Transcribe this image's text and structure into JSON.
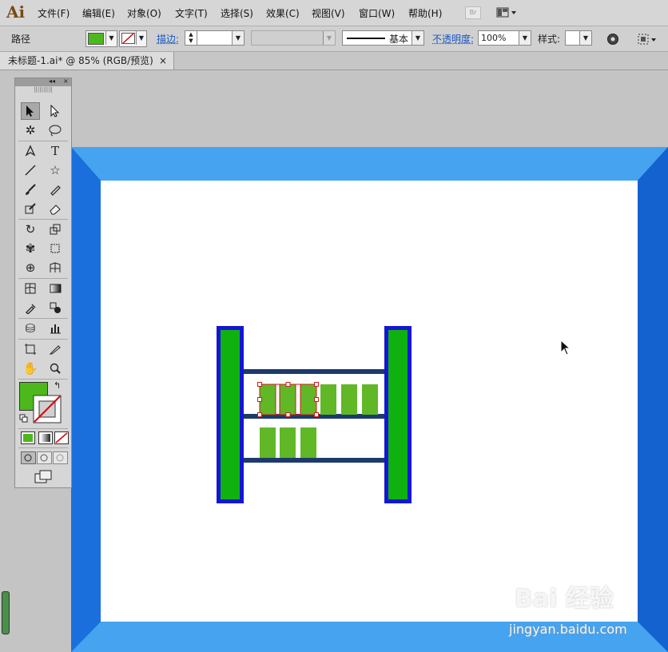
{
  "app": {
    "logo": "Ai"
  },
  "menu": [
    "文件(F)",
    "编辑(E)",
    "对象(O)",
    "文字(T)",
    "选择(S)",
    "效果(C)",
    "视图(V)",
    "窗口(W)",
    "帮助(H)"
  ],
  "bridge_badge": "Br",
  "control": {
    "object_type": "路径",
    "fill_color": "#4cb81c",
    "stroke_label": "描边:",
    "brush_label": "基本",
    "opacity_label": "不透明度:",
    "opacity_value": "100%",
    "style_label": "样式:"
  },
  "document_tab": {
    "title": "未标题-1.ai* @ 85% (RGB/预览)",
    "close": "×"
  },
  "toolbox": {
    "collapse_glyph": "◂◂",
    "close_glyph": "×",
    "fill_color": "#4cb81c"
  },
  "canvas": {
    "frame_color": "#1a6fdc",
    "frame_light": "#45a3f0",
    "shelf_outline": "#1515d6",
    "shelf_pillar": "#0fb10f",
    "shelf_bar": "#1d3a6e",
    "box_color": "#60b827",
    "selection_color": "#d11a1a"
  },
  "watermark": {
    "brand": "Bai 经验",
    "url": "jingyan.baidu.com"
  }
}
